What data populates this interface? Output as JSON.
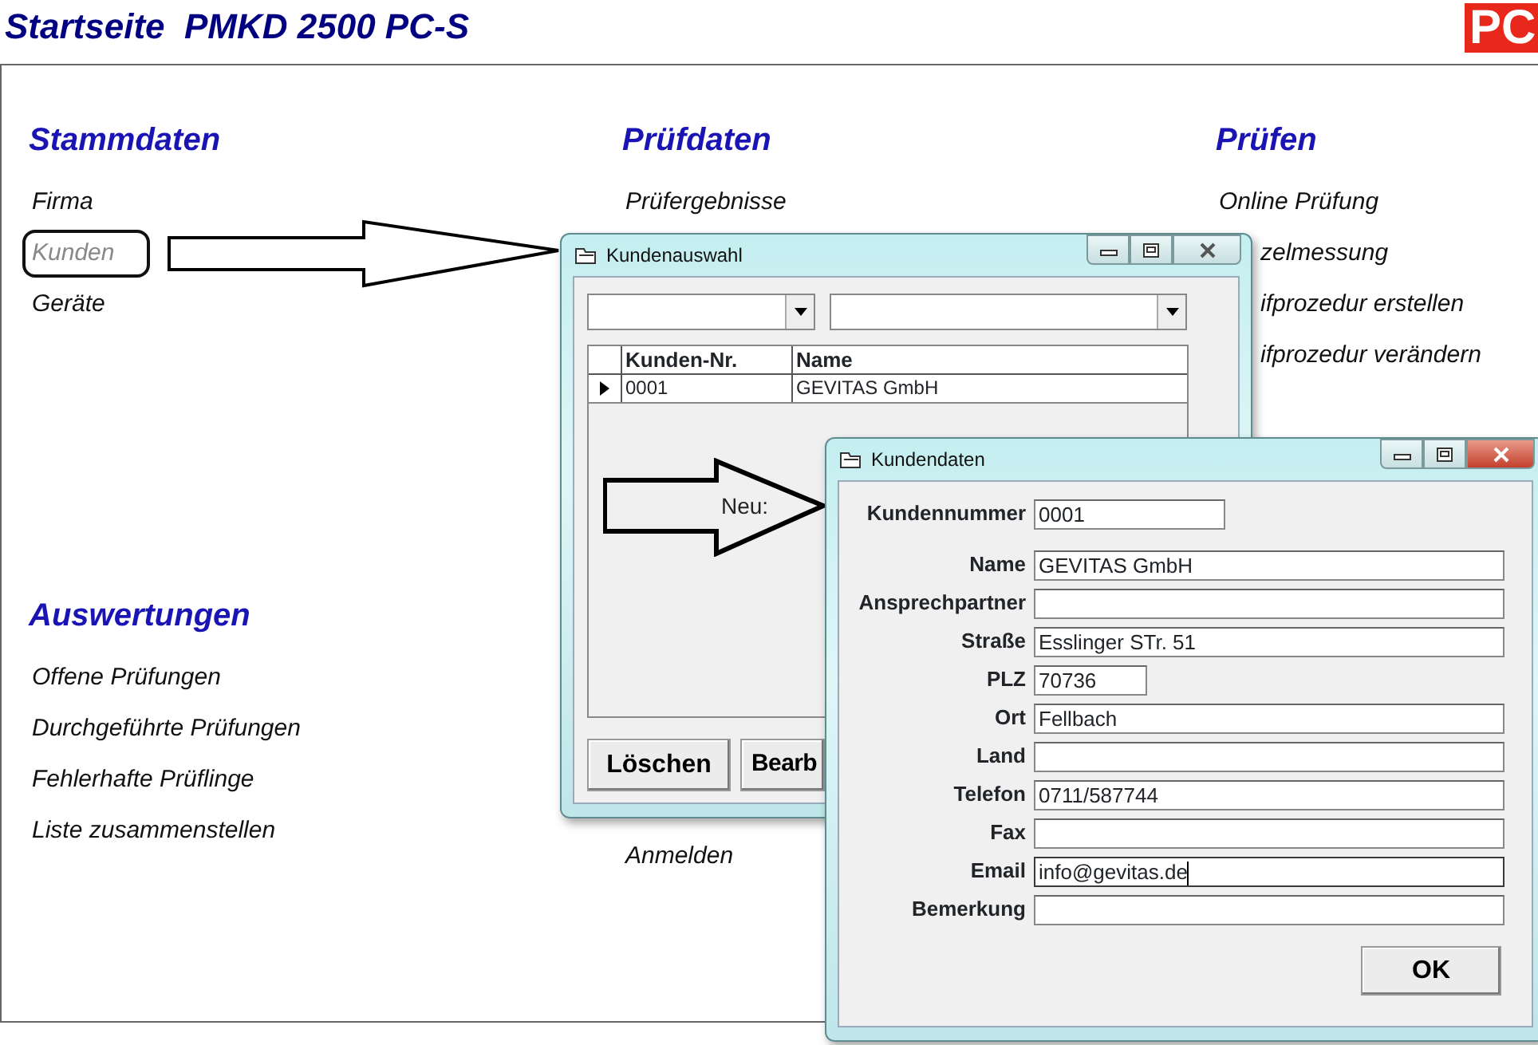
{
  "header": {
    "title": "Startseite  PMKD 2500 PC-S",
    "logo": "PC"
  },
  "sections": [
    {
      "title": "Stammdaten",
      "items": [
        {
          "label": "Firma",
          "kind": "full",
          "selected": false
        },
        {
          "label": "Kunden",
          "kind": "full",
          "selected": true
        },
        {
          "label": "Geräte",
          "kind": "full",
          "selected": false
        }
      ]
    },
    {
      "title": "Prüfdaten",
      "items": [
        {
          "label": "Prüfergebnisse",
          "kind": "full",
          "selected": false
        }
      ]
    },
    {
      "title": "Prüfen",
      "items": [
        {
          "label": "Online Prüfung",
          "kind": "full",
          "selected": false
        },
        {
          "label": "zelmessung",
          "kind": "cut",
          "selected": false
        },
        {
          "label": "ifprozedur erstellen",
          "kind": "cut",
          "selected": false
        },
        {
          "label": "ifprozedur verändern",
          "kind": "cut",
          "selected": false
        }
      ]
    },
    {
      "title": "Auswertungen",
      "items": [
        {
          "label": "Offene Prüfungen",
          "kind": "full",
          "selected": false
        },
        {
          "label": "Durchgeführte Prüfungen",
          "kind": "full",
          "selected": false
        },
        {
          "label": "Fehlerhafte Prüflinge",
          "kind": "full",
          "selected": false
        },
        {
          "label": "Liste zusammenstellen",
          "kind": "full",
          "selected": false
        }
      ]
    },
    {
      "items": [
        {
          "label": "Anmelden",
          "kind": "full",
          "selected": false
        }
      ]
    }
  ],
  "customer_selection": {
    "title": "Kundenauswahl",
    "columns": [
      "Kunden-Nr.",
      "Name"
    ],
    "rows": [
      {
        "cells": [
          "0001",
          "GEVITAS GmbH"
        ],
        "current": true
      }
    ],
    "arrow_label": "Neu:",
    "buttons": [
      "Löschen",
      "Bearb"
    ]
  },
  "customer_data": {
    "title": "Kundendaten",
    "fields": [
      {
        "label": "Kundennummer",
        "value": "0001",
        "kind": "short",
        "focused": false
      },
      {
        "label": "Name",
        "value": "GEVITAS GmbH",
        "kind": "wide",
        "focused": false
      },
      {
        "label": "Ansprechpartner",
        "kind": "wide",
        "focused": false
      },
      {
        "label": "Straße",
        "value": "Esslinger STr. 51",
        "kind": "wide",
        "focused": false
      },
      {
        "label": "PLZ",
        "value": "70736",
        "kind": "zip",
        "focused": false
      },
      {
        "label": "Ort",
        "value": "Fellbach",
        "kind": "wide",
        "focused": false
      },
      {
        "label": "Land",
        "kind": "wide",
        "focused": false
      },
      {
        "label": "Telefon",
        "value": "0711/587744",
        "kind": "wide",
        "focused": false
      },
      {
        "label": "Fax",
        "kind": "wide",
        "focused": false
      },
      {
        "label": "Email",
        "value": "info@gevitas.de",
        "kind": "wide",
        "focused": true
      },
      {
        "label": "Bemerkung",
        "kind": "wide",
        "focused": false
      }
    ],
    "ok_button": "OK"
  }
}
